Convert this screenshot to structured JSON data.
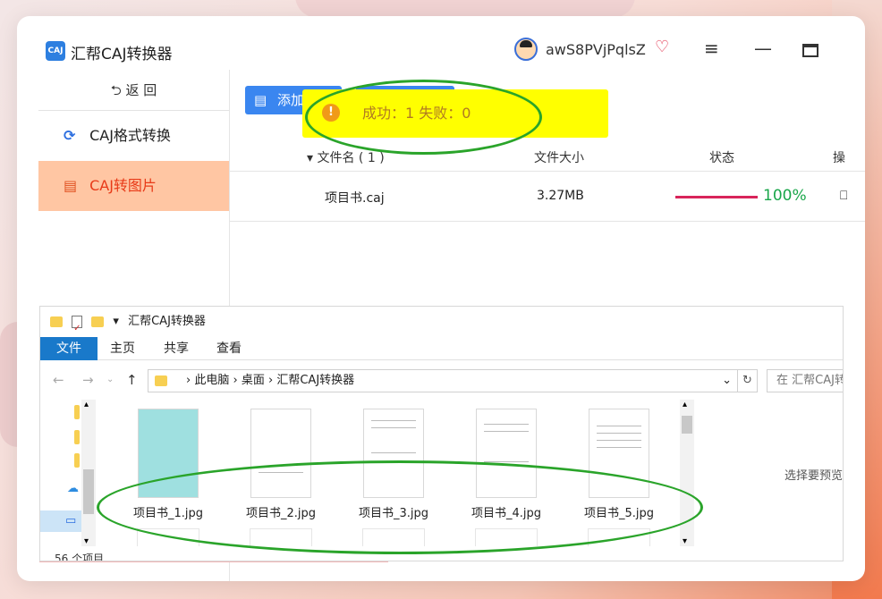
{
  "app": {
    "logo_text": "CAJ",
    "title": "汇帮CAJ转换器",
    "user": "awS8PVjPqlsZ"
  },
  "sidebar": {
    "back": "⮌ 返  回",
    "items": [
      {
        "label": "CAJ格式转换",
        "icon": "refresh-icon"
      },
      {
        "label": "CAJ转图片",
        "icon": "document-icon",
        "active": true
      }
    ]
  },
  "toolbar": {
    "add_label": "添加文"
  },
  "toast": {
    "text": "成功：1   失败：0",
    "icon": "info-icon"
  },
  "table": {
    "headers": [
      "▾ 文件名 ( 1 )",
      "文件大小",
      "状态",
      "操"
    ],
    "rows": [
      {
        "name": "项目书.caj",
        "size": "3.27MB",
        "progress": 1.0,
        "progress_label": "100%",
        "action": "⎕"
      }
    ]
  },
  "explorer": {
    "title": "汇帮CAJ转换器",
    "ribbon": [
      "文件",
      "主页",
      "共享",
      "查看"
    ],
    "path": [
      "此电脑",
      "桌面",
      "汇帮CAJ转换器"
    ],
    "search_placeholder": "在 汇帮CAJ转",
    "files": [
      "项目书_1.jpg",
      "项目书_2.jpg",
      "项目书_3.jpg",
      "项目书_4.jpg",
      "项目书_5.jpg"
    ],
    "preview_hint": "选择要预览",
    "status": "56 个项目"
  },
  "colors": {
    "accent": "#3a86f0",
    "active_bg": "#ffc6a3",
    "active_text": "#e83a18",
    "progress": "#d8245a",
    "success": "#19a64a",
    "toast": "#ffff00",
    "annotation": "#2aa42a"
  }
}
